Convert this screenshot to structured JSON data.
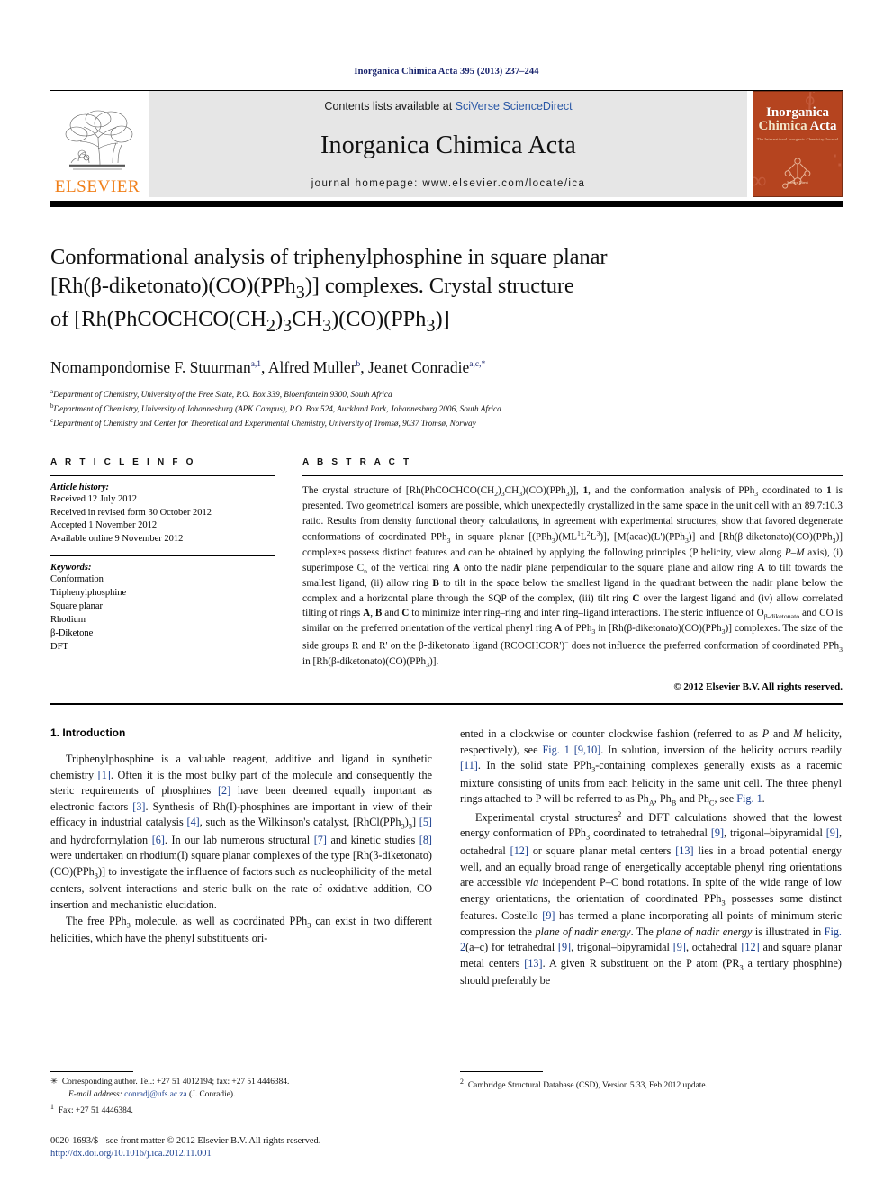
{
  "running_head": "Inorganica Chimica Acta 395 (2013) 237–244",
  "masthead": {
    "publisher_name": "ELSEVIER",
    "contents_prefix": "Contents lists available at ",
    "contents_link": "SciVerse ScienceDirect",
    "journal_name": "Inorganica Chimica Acta",
    "homepage": "journal homepage: www.elsevier.com/locate/ica",
    "cover": {
      "line1": "Inorganica",
      "line2": "Chimica",
      "line3": "Acta",
      "subtitle": "The International Inorganic Chemistry Journal",
      "footer": "Science Direct"
    }
  },
  "title": {
    "line1": "Conformational analysis of triphenylphosphine in square planar",
    "line2_pre": "[Rh(β-diketonato)(CO)(PPh",
    "line2_sub": "3",
    "line2_post": ")] complexes. Crystal structure",
    "line3_a": "of [Rh(PhCOCHCO(CH",
    "line3_s1": "2",
    "line3_b": ")",
    "line3_s2": "3",
    "line3_c": "CH",
    "line3_s3": "3",
    "line3_d": ")(CO)(PPh",
    "line3_s4": "3",
    "line3_e": ")]"
  },
  "authors": {
    "a1_name": "Nomampondomise F. Stuurman",
    "a1_sup": "a,1",
    "a2_name": "Alfred Muller",
    "a2_sup": "b",
    "a3_name": "Jeanet Conradie",
    "a3_sup": "a,c,*"
  },
  "affiliations": [
    {
      "marker": "a",
      "text": "Department of Chemistry, University of the Free State, P.O. Box 339, Bloemfontein 9300, South Africa"
    },
    {
      "marker": "b",
      "text": "Department of Chemistry, University of Johannesburg (APK Campus), P.O. Box 524, Auckland Park, Johannesburg 2006, South Africa"
    },
    {
      "marker": "c",
      "text": "Department of Chemistry and Center for Theoretical and Experimental Chemistry, University of Tromsø, 9037 Tromsø, Norway"
    }
  ],
  "article_info": {
    "heading": "A R T I C L E   I N F O",
    "history_title": "Article history:",
    "history": [
      "Received 12 July 2012",
      "Received in revised form 30 October 2012",
      "Accepted 1 November 2012",
      "Available online 9 November 2012"
    ],
    "keywords_title": "Keywords:",
    "keywords": [
      "Conformation",
      "Triphenylphosphine",
      "Square planar",
      "Rhodium",
      "β-Diketone",
      "DFT"
    ]
  },
  "abstract": {
    "heading": "A B S T R A C T",
    "copyright": "© 2012 Elsevier B.V. All rights reserved."
  },
  "introduction": {
    "section_title": "1. Introduction"
  },
  "footnotes": {
    "corresponding": "Corresponding author. Tel.: +27 51 4012194; fax: +27 51 4446384.",
    "email_label": "E-mail address:",
    "email": "conradj@ufs.ac.za",
    "email_tail": "(J. Conradie).",
    "fax_marker": "1",
    "fax": "Fax: +27 51 4446384.",
    "csd_marker": "2",
    "csd": "Cambridge Structural Database (CSD), Version 5.33, Feb 2012 update."
  },
  "issn": {
    "line1": "0020-1693/$ - see front matter © 2012 Elsevier B.V. All rights reserved.",
    "doi": "http://dx.doi.org/10.1016/j.ica.2012.11.001"
  },
  "colors": {
    "link": "#2b58a6",
    "reference": "#1a3f8f",
    "running_head": "#16216b",
    "elsevier_orange": "#f07f19",
    "cover_red": "#b5441f",
    "band_grey": "#e6e6e6"
  }
}
